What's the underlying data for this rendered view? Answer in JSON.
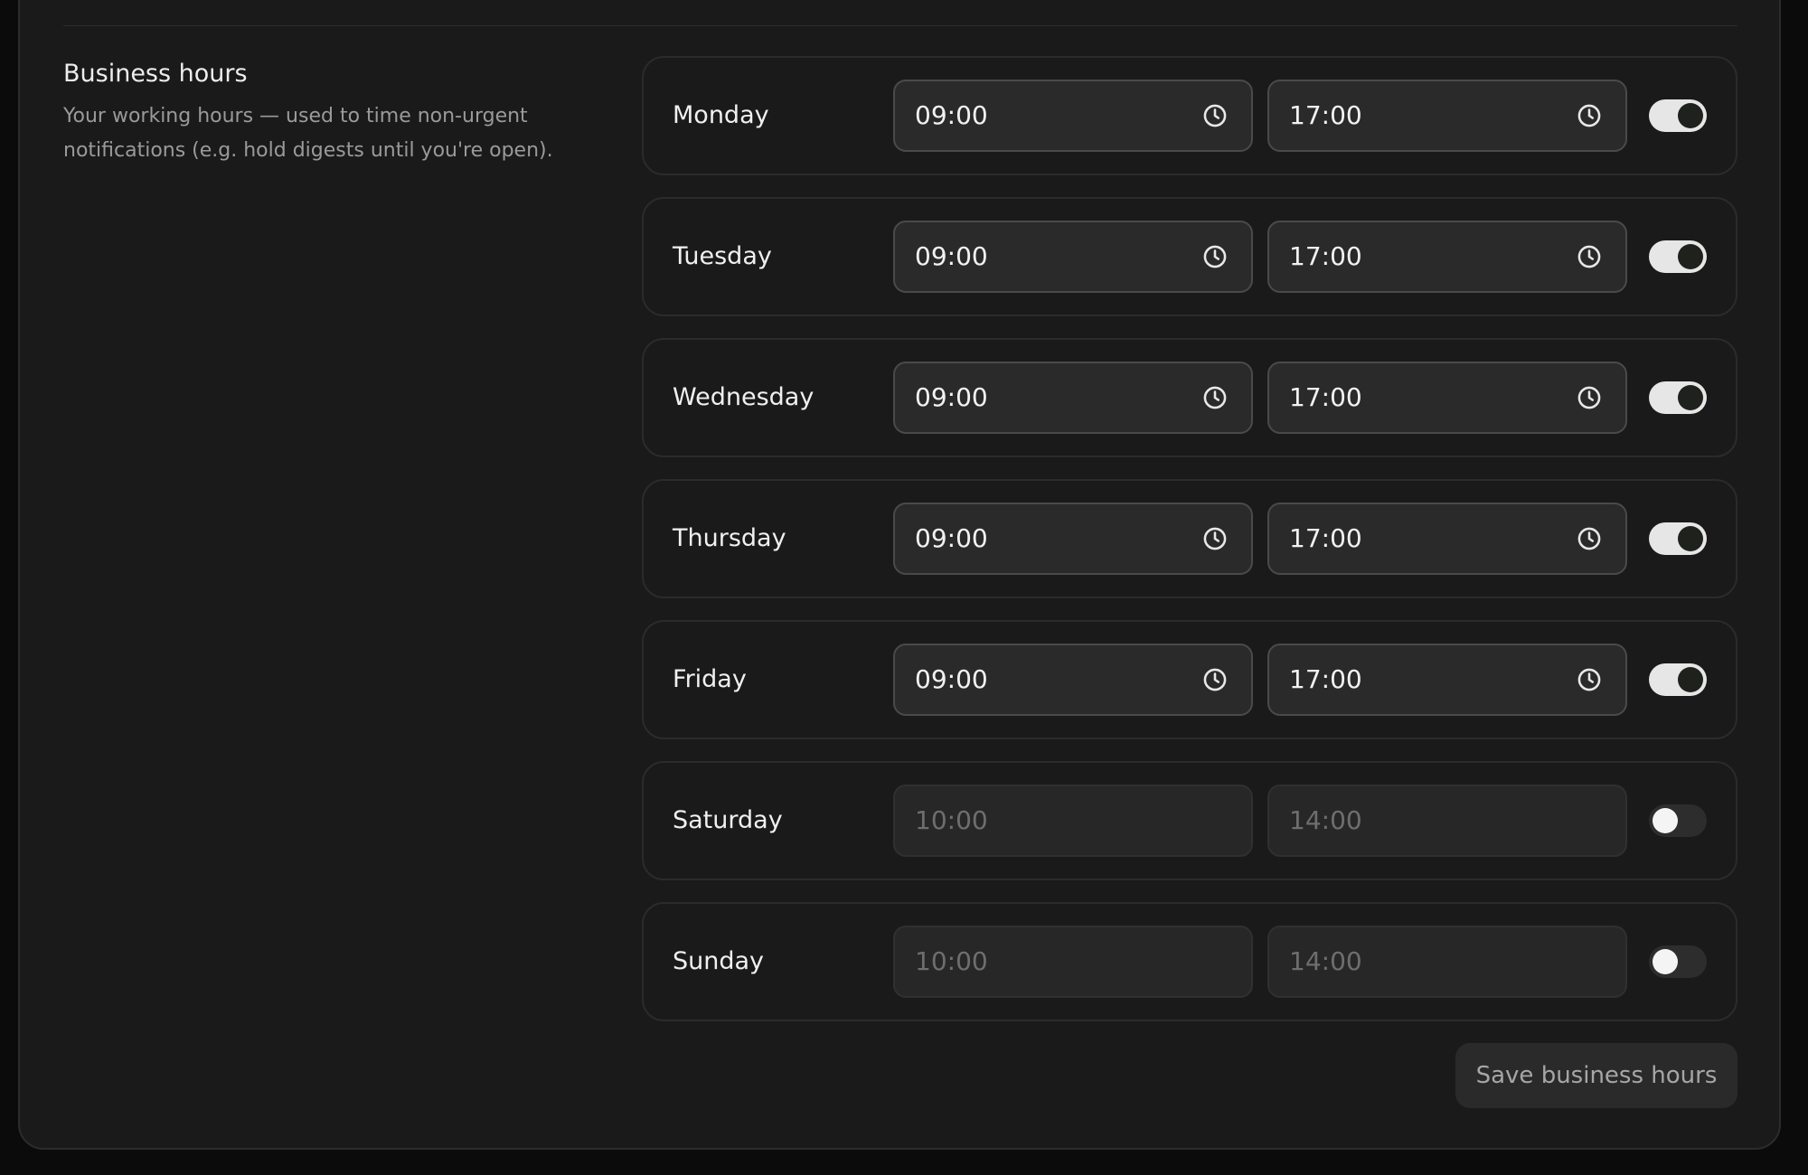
{
  "section": {
    "title": "Business hours",
    "description": "Your working hours — used to time non-urgent notifications (e.g. hold digests until you're open)."
  },
  "days": [
    {
      "name": "Monday",
      "start": "09:00",
      "end": "17:00",
      "enabled": true
    },
    {
      "name": "Tuesday",
      "start": "09:00",
      "end": "17:00",
      "enabled": true
    },
    {
      "name": "Wednesday",
      "start": "09:00",
      "end": "17:00",
      "enabled": true
    },
    {
      "name": "Thursday",
      "start": "09:00",
      "end": "17:00",
      "enabled": true
    },
    {
      "name": "Friday",
      "start": "09:00",
      "end": "17:00",
      "enabled": true
    },
    {
      "name": "Saturday",
      "start": "10:00",
      "end": "14:00",
      "enabled": false
    },
    {
      "name": "Sunday",
      "start": "10:00",
      "end": "14:00",
      "enabled": false
    }
  ],
  "icons": {
    "time_field": "clock-icon"
  },
  "colors": {
    "toggle_on_track": "#e6e6e6",
    "toggle_on_knob": "#1e211c",
    "toggle_off_track": "#2d2d2d",
    "toggle_off_knob": "#f4f4f4"
  },
  "save_button": {
    "label": "Save business hours"
  }
}
